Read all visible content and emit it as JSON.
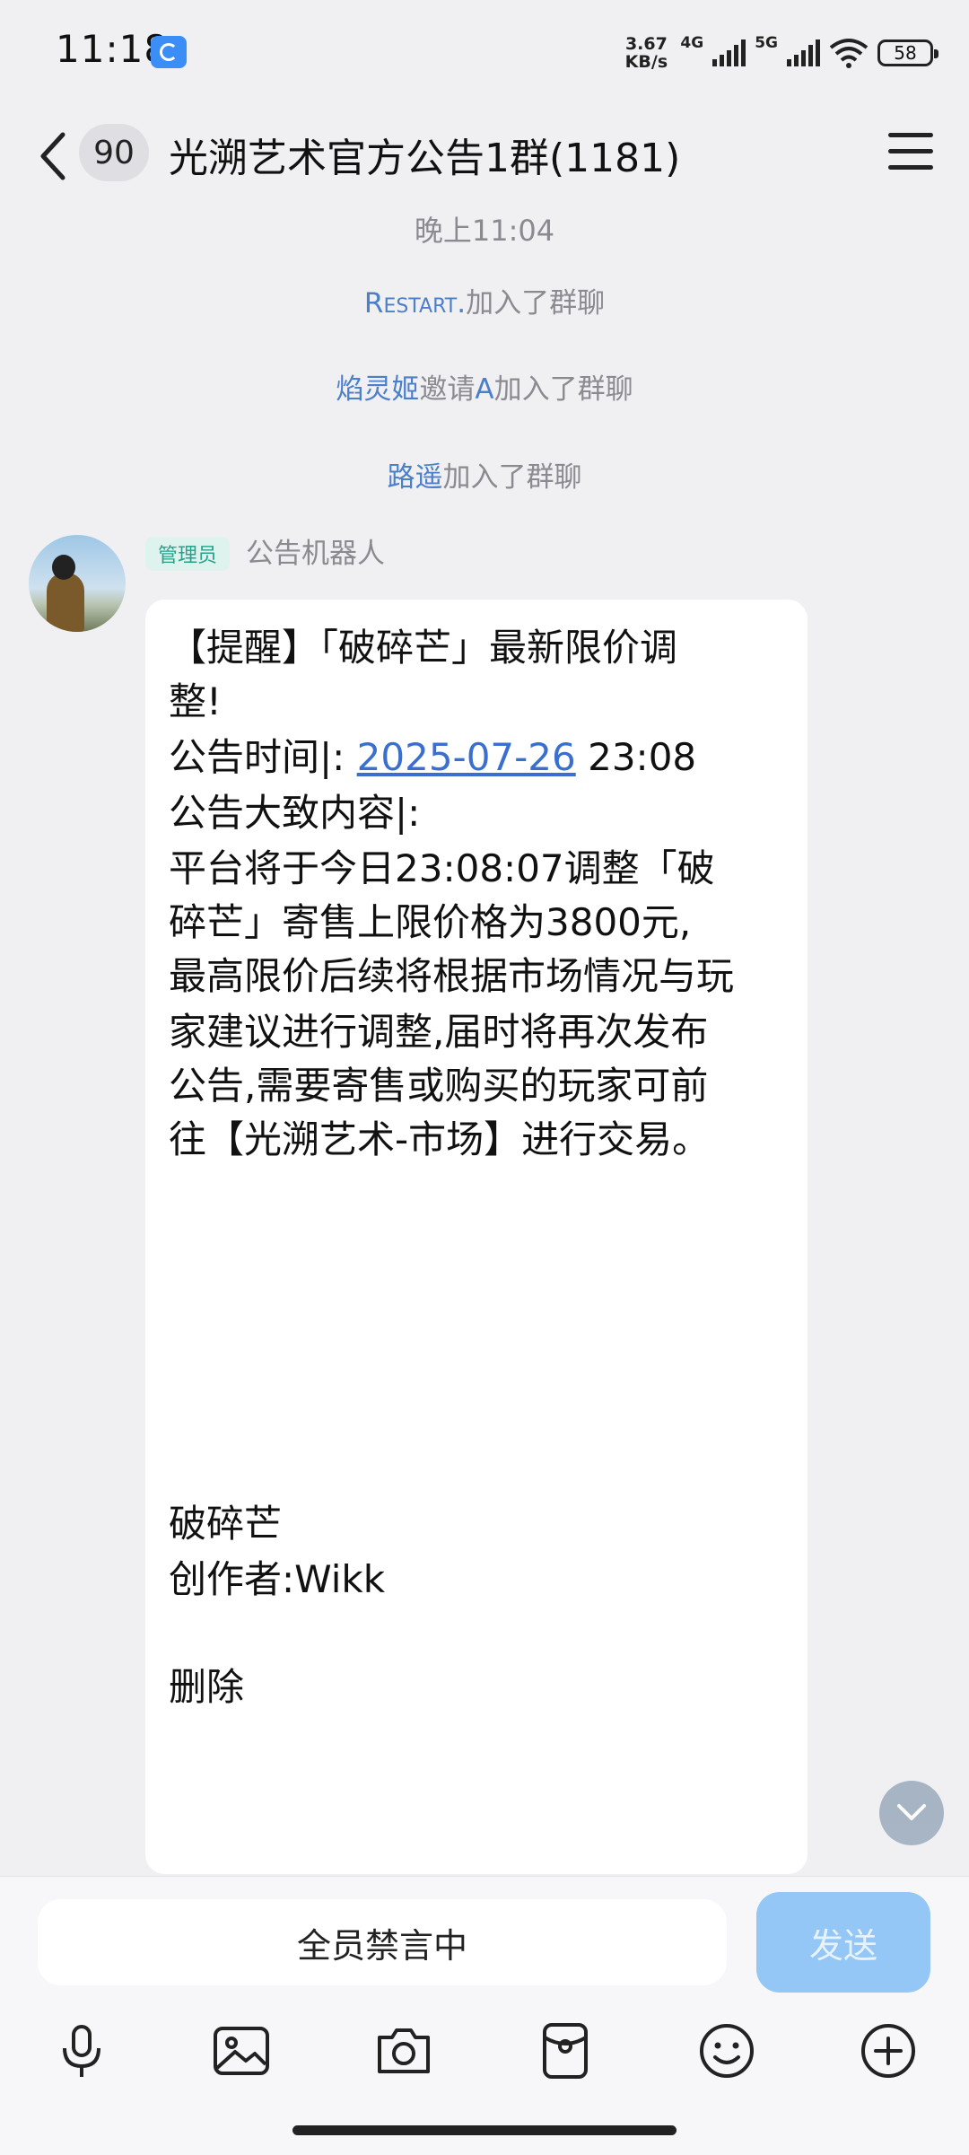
{
  "status_bar": {
    "time": "11:18",
    "net_speed_value": "3.67",
    "net_speed_unit": "KB/s",
    "network_1": "4G",
    "network_2": "5G",
    "battery": "58"
  },
  "header": {
    "unread_count": "90",
    "title": "光溯艺术官方公告1群(1181)"
  },
  "system_messages": {
    "timestamp": "晚上11:04",
    "events": [
      {
        "name": "Restart.",
        "text": "加入了群聊"
      },
      {
        "name": "焰灵姬",
        "mid": "邀请",
        "name2": "A",
        "text": "加入了群聊"
      },
      {
        "name": "路遥",
        "text": "加入了群聊"
      }
    ]
  },
  "message": {
    "role_badge": "管理员",
    "sender": "公告机器人",
    "lines": [
      "【提醒】「破碎芒」最新限价调",
      "整!",
      "公告大致内容|:",
      "平台将于今日23:08:07调整「破",
      "碎芒」寄售上限价格为3800元,",
      "最高限价后续将根据市场情况与玩",
      "家建议进行调整,届时将再次发布",
      "公告,需要寄售或购买的玩家可前",
      "往【光溯艺术-市场】进行交易。",
      "破碎芒",
      "创作者:Wikk",
      "删除"
    ],
    "time_label": "公告时间|: ",
    "time_date": "2025-07-26",
    "time_clock": " 23:08"
  },
  "input": {
    "muted_text": "全员禁言中",
    "send_label": "发送"
  },
  "toolbar_icons": [
    "microphone-icon",
    "image-icon",
    "camera-icon",
    "red-packet-icon",
    "emoji-icon",
    "plus-icon"
  ]
}
